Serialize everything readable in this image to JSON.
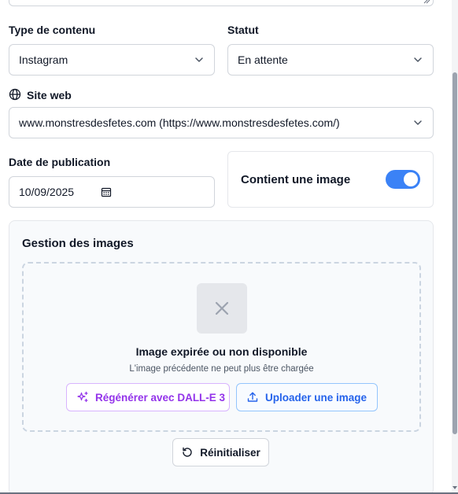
{
  "form": {
    "content_type": {
      "label": "Type de contenu",
      "value": "Instagram"
    },
    "status": {
      "label": "Statut",
      "value": "En attente"
    },
    "website": {
      "label": "Site web",
      "value": "www.monstresdesfetes.com (https://www.monstresdesfetes.com/)"
    },
    "publication_date": {
      "label": "Date de publication",
      "value": "10/09/2025"
    },
    "has_image": {
      "label": "Contient une image",
      "enabled": true
    }
  },
  "image_management": {
    "title": "Gestion des images",
    "message": "Image expirée ou non disponible",
    "submessage": "L'image précédente ne peut plus être chargée",
    "regenerate_label": "Régénérer avec DALL-E 3",
    "upload_label": "Uploader une image",
    "reset_label": "Réinitialiser"
  },
  "colors": {
    "accent_blue": "#3b82f6",
    "dalle_purple": "#9333ea",
    "upload_blue": "#2563eb"
  }
}
